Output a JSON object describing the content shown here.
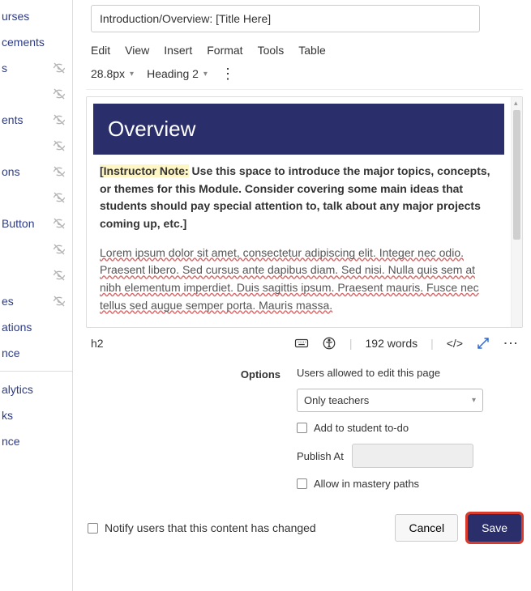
{
  "sidebar": {
    "items": [
      {
        "label": "urses",
        "hidden": false
      },
      {
        "label": "cements",
        "hidden": false
      },
      {
        "label": "s",
        "hidden": true
      },
      {
        "label": "",
        "hidden": true
      },
      {
        "label": "ents",
        "hidden": true
      },
      {
        "label": "",
        "hidden": true
      },
      {
        "label": "ons",
        "hidden": true
      },
      {
        "label": "",
        "hidden": true
      },
      {
        "label": "Button",
        "hidden": true
      },
      {
        "label": "",
        "hidden": true
      },
      {
        "label": "",
        "hidden": true
      },
      {
        "label": "es",
        "hidden": true
      },
      {
        "label": "ations",
        "hidden": false
      },
      {
        "label": "nce",
        "hidden": false
      },
      {
        "label": "alytics",
        "hidden": false
      },
      {
        "label": "ks",
        "hidden": false
      },
      {
        "label": "nce",
        "hidden": false
      }
    ]
  },
  "title_field": {
    "value": "Introduction/Overview: [Title Here]"
  },
  "menu": {
    "edit": "Edit",
    "view": "View",
    "insert": "Insert",
    "format": "Format",
    "tools": "Tools",
    "table": "Table"
  },
  "toolbar": {
    "font_size": "28.8px",
    "style": "Heading 2"
  },
  "editor": {
    "banner": "Overview",
    "instructor_note_label": "[Instructor Note:",
    "instructor_note_body": " Use this space to introduce the major topics, concepts, or themes for this Module. Consider covering some main ideas that students should pay special attention to, talk about any major projects coming up, etc.]",
    "lorem": "Lorem ipsum dolor sit amet, consectetur adipiscing elit. Integer nec odio. Praesent libero. Sed cursus ante dapibus diam. Sed nisi. Nulla quis sem at nibh elementum imperdiet. Duis sagittis ipsum. Praesent mauris. Fusce nec tellus sed augue semper porta. Mauris massa."
  },
  "statusbar": {
    "path": "h2",
    "word_count": "192 words",
    "code_label": "</>"
  },
  "options": {
    "label": "Options",
    "users_label": "Users allowed to edit this page",
    "select_value": "Only teachers",
    "add_todo": "Add to student to-do",
    "publish_at": "Publish At",
    "mastery": "Allow in mastery paths"
  },
  "footer": {
    "notify": "Notify users that this content has changed",
    "cancel": "Cancel",
    "save": "Save"
  },
  "colors": {
    "accent": "#2a2f6b",
    "highlight": "#d83a2b"
  }
}
